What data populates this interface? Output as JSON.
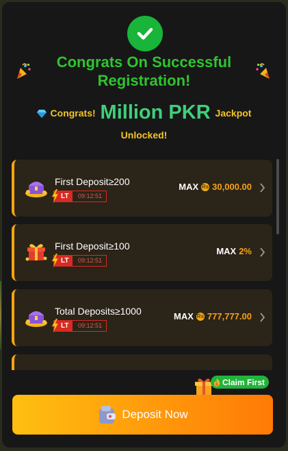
{
  "modal": {
    "title": "Congrats On Successful Registration!",
    "subtitle_prefix": "Congrats!",
    "subtitle_highlight": "Million PKR",
    "subtitle_suffix": "Jackpot",
    "subtitle_line2": "Unlocked!"
  },
  "offers": [
    {
      "name": "First Deposit≥200",
      "badge": "LT",
      "timer": "09:12:51",
      "max_label": "MAX",
      "currency_symbol": "Rs",
      "amount": "30,000.00"
    },
    {
      "name": "First Deposit≥100",
      "badge": "LT",
      "timer": "09:12:51",
      "max_label": "MAX",
      "currency_symbol": "",
      "amount": "2%"
    },
    {
      "name": "Total Deposits≥1000",
      "badge": "LT",
      "timer": "09:12:51",
      "max_label": "MAX",
      "currency_symbol": "Rs",
      "amount": "777,777.00"
    }
  ],
  "claim_first": "Claim First",
  "deposit_button": "Deposit Now",
  "colors": {
    "accent_green": "#2fc430",
    "jackpot_green": "#3fcf7a",
    "gold": "#f3c428",
    "orange": "#f6a21a",
    "card_bg": "#2b2418",
    "timer_red": "#d92a23"
  },
  "icons": [
    "check-icon",
    "party-popper-icon",
    "gem-icon",
    "treasure-chest-icon",
    "gift-box-icon",
    "lightning-icon",
    "coin-icon",
    "chevron-right-icon",
    "flame-icon",
    "wallet-icon"
  ]
}
